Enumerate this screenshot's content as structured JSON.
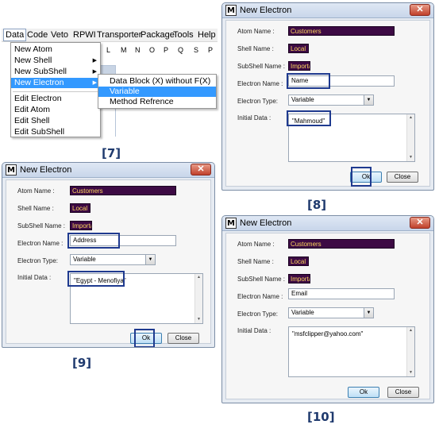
{
  "panel7": {
    "menubar": [
      "Data",
      "Code",
      "Veto",
      "RPWI",
      "Transporter",
      "Package",
      "Tools",
      "Help"
    ],
    "letters": [
      "L",
      "M",
      "N",
      "O",
      "P",
      "Q",
      "S",
      "P"
    ],
    "dropdown": [
      "New Atom",
      "New Shell",
      "New SubShell",
      "New Electron",
      "Edit Electron",
      "Edit Atom",
      "Edit Shell",
      "Edit SubShell"
    ],
    "submenu": [
      "Data Block (X) without F(X)",
      "Variable",
      "Method Refrence"
    ],
    "caption": "[7]"
  },
  "dialog": {
    "app_icon": "M",
    "title": "New Electron",
    "close_glyph": "✕",
    "labels": {
      "atom": "Atom Name :",
      "shell": "Shell Name :",
      "subshell": "SubShell Name :",
      "electron": "Electron Name :",
      "type": "Electron Type:",
      "initial": "Initial Data :"
    },
    "atom_value": "Customers",
    "shell_value": "Local",
    "subshell_value": "Importa",
    "type_value": "Variable",
    "ok": "Ok",
    "close": "Close"
  },
  "panel8": {
    "electron_name": "Name",
    "initial_data": "\"Mahmoud\"",
    "caption": "[8]"
  },
  "panel9": {
    "electron_name": "Address",
    "initial_data": "\"Egypt - Menofiya\"",
    "caption": "[9]"
  },
  "panel10": {
    "electron_name": "Email",
    "initial_data": "\"msfclipper@yahoo.com\"",
    "caption": "[10]"
  },
  "colors": {
    "caption": "#1f3a6e",
    "highlight_box": "#1f3a8f",
    "dark_field": "#3d0a44",
    "dark_field_text": "#ffd75e",
    "menu_highlight": "#3399ff"
  }
}
